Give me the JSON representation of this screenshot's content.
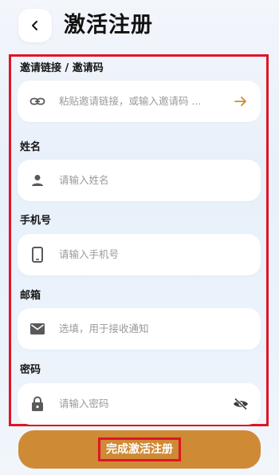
{
  "header": {
    "title": "激活注册"
  },
  "form": {
    "invite": {
      "label": "邀请链接 / 邀请码",
      "placeholder": "粘贴邀请链接，或输入邀请码 ..."
    },
    "name": {
      "label": "姓名",
      "placeholder": "请输入姓名"
    },
    "phone": {
      "label": "手机号",
      "placeholder": "请输入手机号"
    },
    "email": {
      "label": "邮箱",
      "placeholder": "选填，用于接收通知"
    },
    "password": {
      "label": "密码",
      "placeholder": "请输入密码"
    }
  },
  "submit": {
    "label": "完成激活注册"
  },
  "colors": {
    "accent": "#cf8a36",
    "highlight": "#e01425",
    "icon": "#5a5a5a"
  }
}
